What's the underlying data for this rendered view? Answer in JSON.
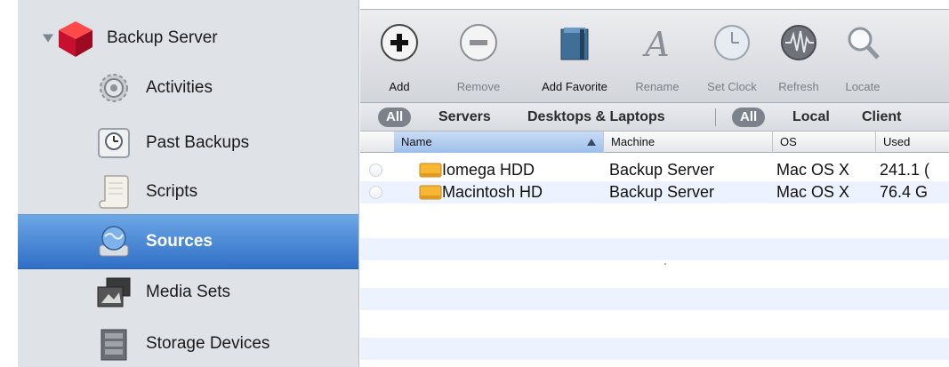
{
  "sidebar": {
    "items": [
      {
        "label": "Backup Server",
        "icon": "backup-server-cube-icon"
      },
      {
        "label": "Activities",
        "icon": "gear-icon"
      },
      {
        "label": "Past Backups",
        "icon": "clock-drive-icon"
      },
      {
        "label": "Scripts",
        "icon": "scroll-icon"
      },
      {
        "label": "Sources",
        "icon": "sources-globe-icon",
        "selected": true
      },
      {
        "label": "Media Sets",
        "icon": "media-sets-icon"
      },
      {
        "label": "Storage Devices",
        "icon": "storage-devices-icon"
      }
    ]
  },
  "toolbar": {
    "add": "Add",
    "remove": "Remove",
    "add_favorite": "Add Favorite",
    "rename": "Rename",
    "set_clock": "Set Clock",
    "refresh": "Refresh",
    "locate": "Locate"
  },
  "filters": {
    "all_1": "All",
    "servers": "Servers",
    "desktops_laptops": "Desktops & Laptops",
    "all_2": "All",
    "local": "Local",
    "client": "Client"
  },
  "table": {
    "columns": [
      "Name",
      "Machine",
      "OS",
      "Used"
    ],
    "sorted_column": "Name",
    "rows": [
      {
        "name": "Iomega HDD",
        "machine": "Backup Server",
        "os": "Mac OS X",
        "used": "241.1 ("
      },
      {
        "name": "Macintosh HD",
        "machine": "Backup Server",
        "os": "Mac OS X",
        "used": "76.4 G"
      }
    ]
  },
  "colors": {
    "sidebar_bg": "#dfe3e8",
    "selection": "#3a7bd5",
    "row_alt": "#edf3fe",
    "brand_red": "#c8102e"
  }
}
